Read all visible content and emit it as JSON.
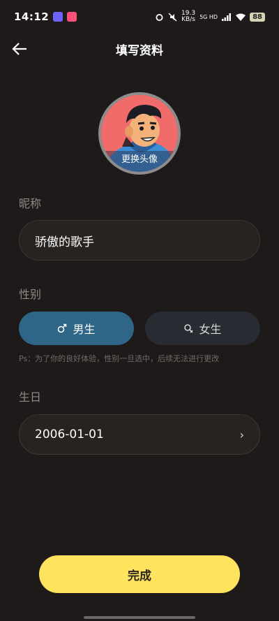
{
  "status_bar": {
    "time": "14:12",
    "speed_value": "19.3",
    "speed_unit": "KB/s",
    "network": "5G HD",
    "battery": "88"
  },
  "header": {
    "title": "填写资料"
  },
  "avatar": {
    "caption": "更换头像"
  },
  "nickname": {
    "label": "昵称",
    "value": "骄傲的歌手"
  },
  "gender": {
    "label": "性别",
    "male": "男生",
    "female": "女生",
    "hint": "Ps：为了你的良好体验，性别一旦选中，后续无法进行更改"
  },
  "birthday": {
    "label": "生日",
    "value": "2006-01-01"
  },
  "submit": {
    "label": "完成"
  }
}
